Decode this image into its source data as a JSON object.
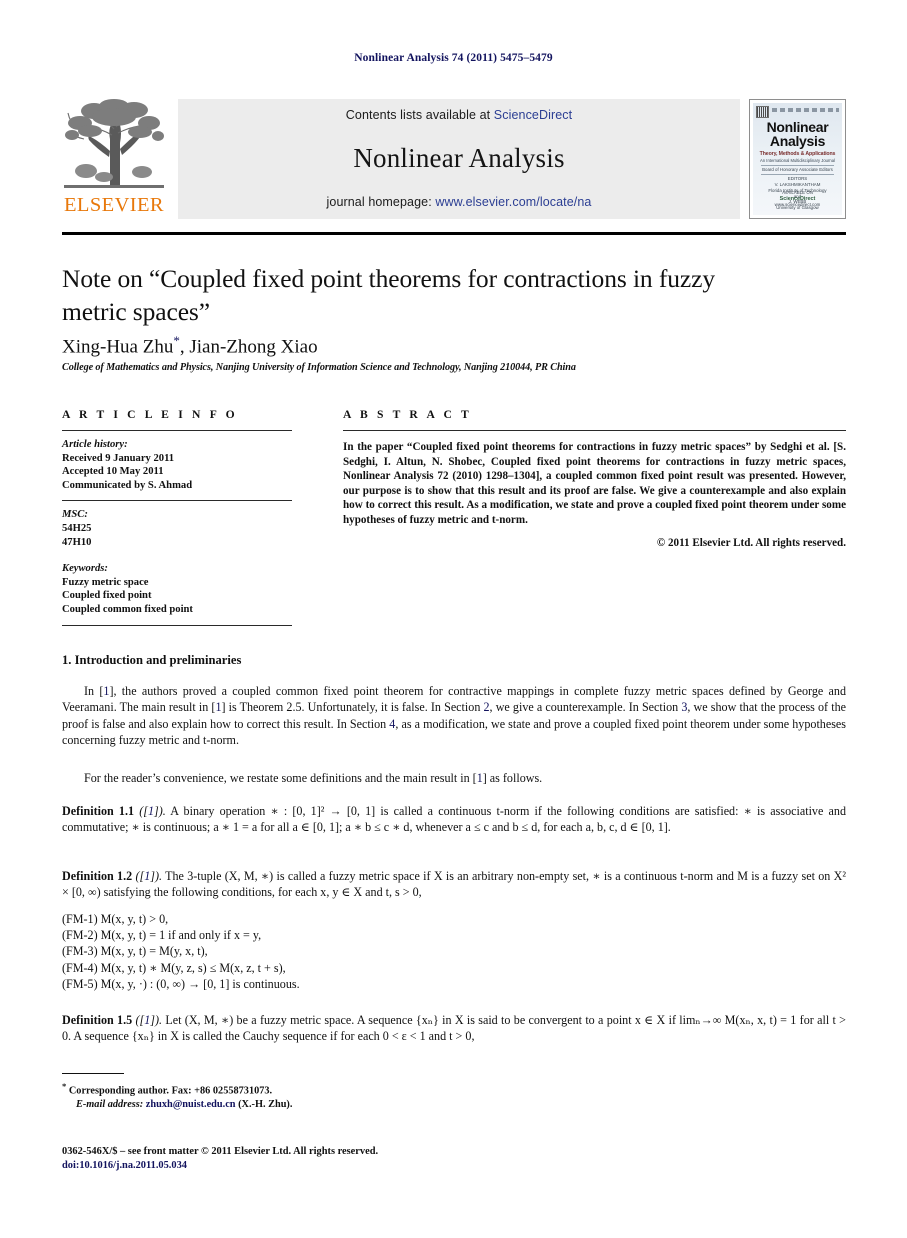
{
  "running_head": "Nonlinear Analysis 74 (2011) 5475–5479",
  "masthead": {
    "elsevier_wordmark": "ELSEVIER",
    "contents_prefix": "Contents lists available at ",
    "sciencedirect": "ScienceDirect",
    "journal_title": "Nonlinear Analysis",
    "homepage_prefix": "journal homepage: ",
    "homepage_url": "www.elsevier.com/locate/na",
    "cover": {
      "title_line1": "Nonlinear",
      "title_line2": "Analysis",
      "subtitle": "Theory, Methods & Applications",
      "subtitle2": "An International Multidisciplinary Journal",
      "editors_label": "EDITORS",
      "editor1": "V. LAKSHMIKANTHAM",
      "editor1_affil": "Florida Institute of Technology",
      "and": "and",
      "editor2": "J. WEBB",
      "editor2_affil": "University of Glasgow",
      "avail_label": "AVAILABLE ON",
      "sciencedirect": "ScienceDirect",
      "sd_url": "www.sciencedirect.com",
      "board_line": "Board of Honorary Associate Editors"
    }
  },
  "article": {
    "title": "Note on “Coupled fixed point theorems for contractions in fuzzy metric spaces”",
    "authors": "Xing-Hua Zhu",
    "authors_mark": "*",
    "authors_rest": ", Jian-Zhong Xiao",
    "affiliation": "College of Mathematics and Physics, Nanjing University of Information Science and Technology, Nanjing 210044, PR China"
  },
  "article_info": {
    "heading": "A R T I C L E    I N F O",
    "history_label": "Article history:",
    "received": "Received 9 January 2011",
    "accepted": "Accepted 10 May 2011",
    "communicated": "Communicated by S. Ahmad",
    "msc_label": "MSC:",
    "msc": [
      "54H25",
      "47H10"
    ],
    "keywords_label": "Keywords:",
    "keywords": [
      "Fuzzy metric space",
      "Coupled fixed point",
      "Coupled common fixed point"
    ]
  },
  "abstract": {
    "heading": "A B S T R A C T",
    "text": "In the paper “Coupled fixed point theorems for contractions in fuzzy metric spaces” by Sedghi et al. [S. Sedghi, I. Altun, N. Shobec, Coupled fixed point theorems for contractions in fuzzy metric spaces, Nonlinear Analysis 72 (2010) 1298–1304], a coupled common fixed point result was presented. However, our purpose is to show that this result and its proof are false. We give a counterexample and also explain how to correct this result. As a modification, we state and prove a coupled fixed point theorem under some hypotheses of fuzzy metric and t-norm.",
    "copyright": "© 2011 Elsevier Ltd. All rights reserved."
  },
  "body": {
    "section1_title": "1. Introduction and preliminaries",
    "para1_a": "In [",
    "para1_ref1": "1",
    "para1_b": "], the authors proved a coupled common fixed point theorem for contractive mappings in complete fuzzy metric spaces defined by George and Veeramani. The main result in [",
    "para1_ref2": "1",
    "para1_c": "] is Theorem 2.5. Unfortunately, it is false. In Section ",
    "para1_ref3": "2",
    "para1_d": ", we give a counterexample. In Section ",
    "para1_ref4": "3",
    "para1_e": ", we show that the process of the proof is false and also explain how to correct this result. In Section ",
    "para1_ref5": "4",
    "para1_f": ", as a modification, we state and prove a coupled fixed point theorem under some hypotheses concerning fuzzy metric and t-norm.",
    "para2_a": "For the reader’s convenience, we restate some definitions and the main result in [",
    "para2_ref": "1",
    "para2_b": "] as follows.",
    "def11_label": "Definition 1.1",
    "def11_cite_open": "([",
    "def11_cite_num": "1",
    "def11_cite_close": "]).",
    "def11_text": " A binary operation ∗ : [0, 1]² → [0, 1] is called a continuous t-norm if the following conditions are satisfied: ∗ is associative and commutative; ∗ is continuous; a ∗ 1 = a for all a ∈ [0, 1]; a ∗ b ≤ c ∗ d, whenever a ≤ c and b ≤ d, for each a, b, c, d ∈ [0, 1].",
    "def12_label": "Definition 1.2",
    "def12_text": " The 3-tuple (X, M, ∗) is called a fuzzy metric space if X is an arbitrary non-empty set, ∗ is a continuous t-norm and M is a fuzzy set on X² × [0, ∞) satisfying the following conditions, for each x, y ∈ X and t, s > 0,",
    "fm_conditions": [
      "(FM-1) M(x, y, t) > 0,",
      "(FM-2) M(x, y, t) = 1 if and only if x = y,",
      "(FM-3) M(x, y, t) = M(y, x, t),",
      "(FM-4) M(x, y, t) ∗ M(y, z, s) ≤ M(x, z, t + s),",
      "(FM-5) M(x, y, ·) : (0, ∞) → [0, 1] is continuous."
    ],
    "def15_label": "Definition 1.5",
    "def15_text": " Let (X, M, ∗) be a fuzzy metric space. A sequence {xₙ} in X is said to be convergent to a point x ∈ X if limₙ→∞ M(xₙ, x, t) = 1 for all t > 0. A sequence {xₙ} in X is called the Cauchy sequence if for each 0 < ε < 1 and t > 0,"
  },
  "footnotes": {
    "corresponding_mark": "*",
    "corresponding": " Corresponding author. Fax: +86 02558731073.",
    "email_label": "E-mail address:",
    "email": "zhuxh@nuist.edu.cn",
    "email_owner": " (X.-H. Zhu)."
  },
  "imprint": {
    "front_matter": "0362-546X/$ – see front matter © 2011 Elsevier Ltd. All rights reserved.",
    "doi": "doi:10.1016/j.na.2011.05.034"
  },
  "colors": {
    "link_blue": "#12135e",
    "sd_blue": "#2b3e93",
    "elsevier_orange": "#e8780a",
    "banner_gray": "#ececec"
  }
}
